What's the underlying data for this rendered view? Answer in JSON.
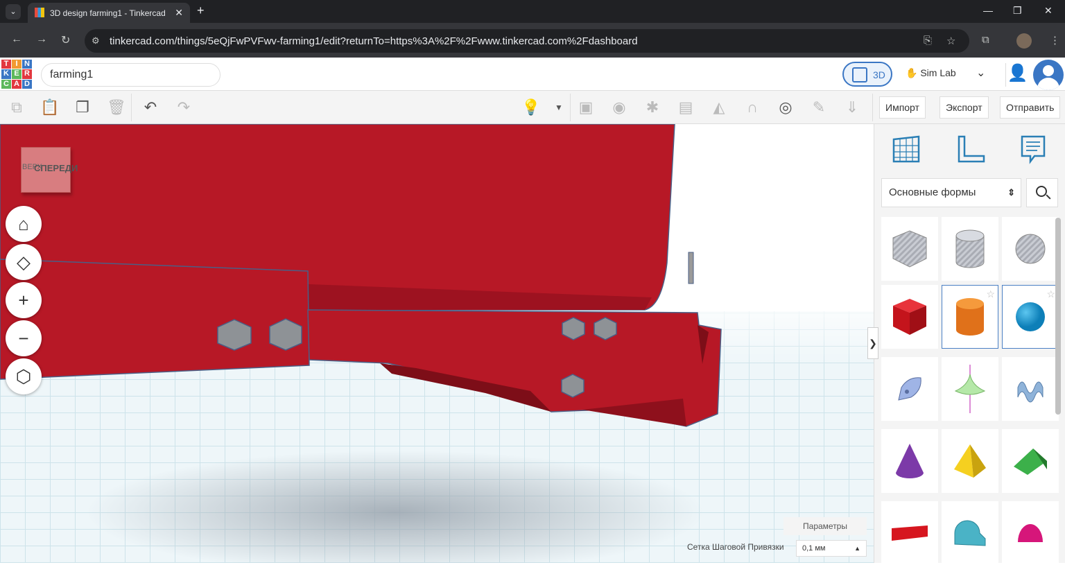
{
  "browser": {
    "tab_title": "3D design farming1 - Tinkercad",
    "url": "tinkercad.com/things/5eQjFwPVFwv-farming1/edit?returnTo=https%3A%2F%2Fwww.tinkercad.com%2Fdashboard"
  },
  "app": {
    "logo_letters": [
      "T",
      "I",
      "N",
      "K",
      "E",
      "R",
      "C",
      "A",
      "D"
    ],
    "design_name": "farming1",
    "mode_label": "3D",
    "simlab_label": "Sim Lab"
  },
  "toolbar": {
    "import_label": "Импорт",
    "export_label": "Экспорт",
    "send_label": "Отправить"
  },
  "viewport": {
    "viewcube_face": "СПЕРЕДИ",
    "viewcube_side": "ВЕРХ",
    "settings_label": "Параметры",
    "snap_label": "Сетка Шаговой Привязки",
    "snap_value": "0,1 мм",
    "object_color": "#b71826"
  },
  "panel": {
    "shape_category": "Основные формы",
    "shapes": [
      {
        "name": "box-hole",
        "color": "#b9bcc4"
      },
      {
        "name": "cylinder-hole",
        "color": "#c9ccd3"
      },
      {
        "name": "sphere-hole",
        "color": "#b0b3ba"
      },
      {
        "name": "box",
        "color": "#d6161f"
      },
      {
        "name": "cylinder",
        "color": "#e87b19"
      },
      {
        "name": "sphere",
        "color": "#1a9ad6"
      },
      {
        "name": "scribble",
        "color": "#8ea5d8"
      },
      {
        "name": "spinning-top",
        "color": "#aee3a0"
      },
      {
        "name": "wave",
        "color": "#8fb3d9"
      },
      {
        "name": "cone",
        "color": "#7c3aa8"
      },
      {
        "name": "pyramid",
        "color": "#e8c319"
      },
      {
        "name": "roof",
        "color": "#2e9a3a"
      },
      {
        "name": "text",
        "color": "#d6161f"
      },
      {
        "name": "half-cylinder",
        "color": "#3fa5b8"
      },
      {
        "name": "paraboloid",
        "color": "#d6167a"
      }
    ]
  }
}
